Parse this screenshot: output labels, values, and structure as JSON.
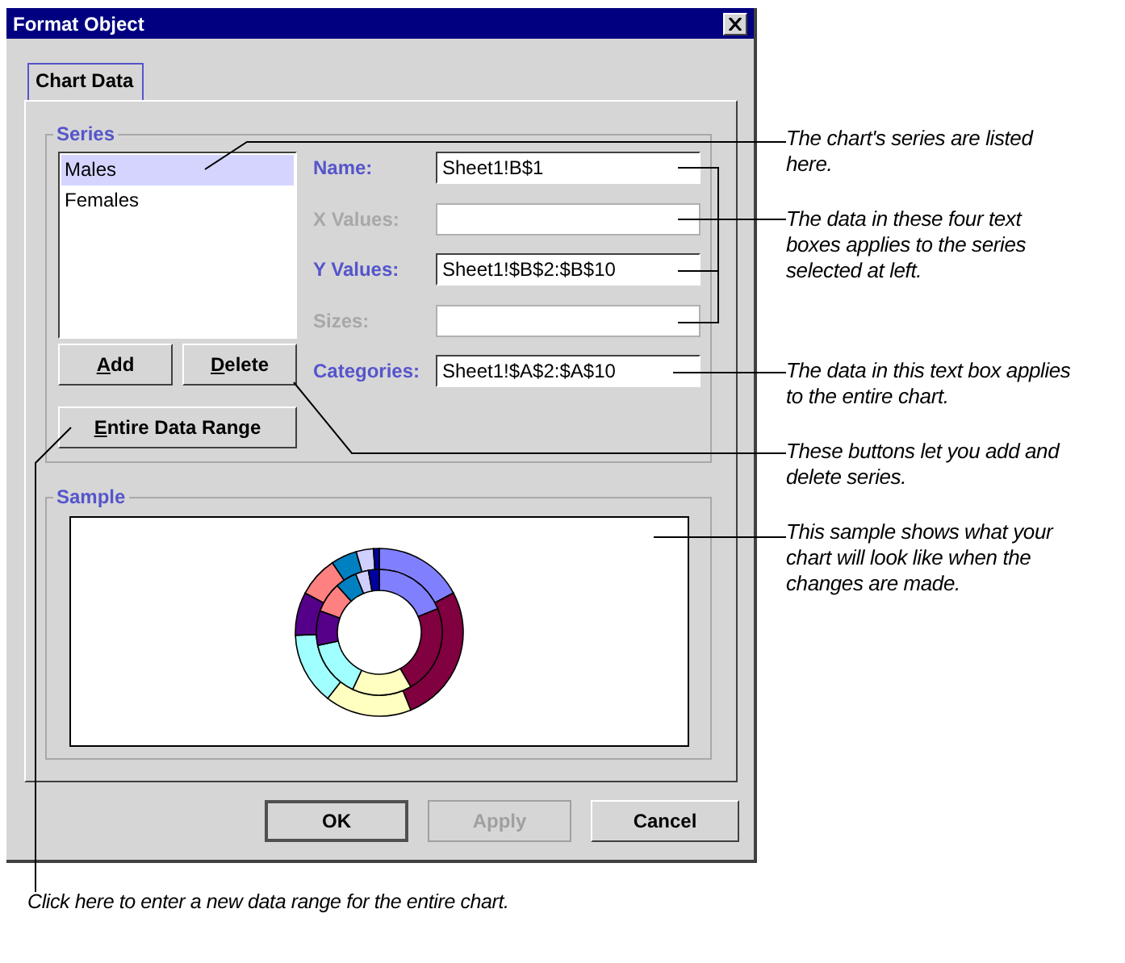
{
  "window": {
    "title": "Format Object"
  },
  "tabs": [
    {
      "label": "Chart Data",
      "selected": true
    }
  ],
  "series_group": {
    "title": "Series",
    "items": [
      {
        "label": "Males",
        "selected": true
      },
      {
        "label": "Females",
        "selected": false
      }
    ],
    "fields": [
      {
        "label": "Name:",
        "value": "Sheet1!B$1",
        "disabled": false
      },
      {
        "label": "X Values:",
        "disabled": true
      },
      {
        "label": "Y Values:",
        "value": "Sheet1!$B$2:$B$10",
        "disabled": false
      },
      {
        "label": "Sizes:",
        "disabled": true
      },
      {
        "label": "Categories:",
        "value": "Sheet1!$A$2:$A$10",
        "disabled": false
      }
    ],
    "buttons": [
      {
        "label": "Add",
        "mnemonic": true
      },
      {
        "label": "Delete",
        "mnemonic": true
      }
    ],
    "range_button": {
      "label": "Entire Data Range",
      "mnemonic": true
    }
  },
  "sample_group": {
    "title": "Sample"
  },
  "buttons": [
    {
      "label": "OK",
      "default": true,
      "disabled": false
    },
    {
      "label": "Apply",
      "default": false,
      "disabled": true
    },
    {
      "label": "Cancel",
      "default": false,
      "disabled": false
    }
  ],
  "callouts": [
    {
      "text": "The chart's series are listed here."
    },
    {
      "text": "The data in these four text boxes applies to the series selected at left."
    },
    {
      "text": "The data in this text box applies to the entire chart."
    },
    {
      "text": "These buttons let you add and delete series."
    },
    {
      "text": "This sample shows what your chart will look like when the changes are made."
    }
  ],
  "caption": "Click here to enter a new data range for the entire chart."
}
